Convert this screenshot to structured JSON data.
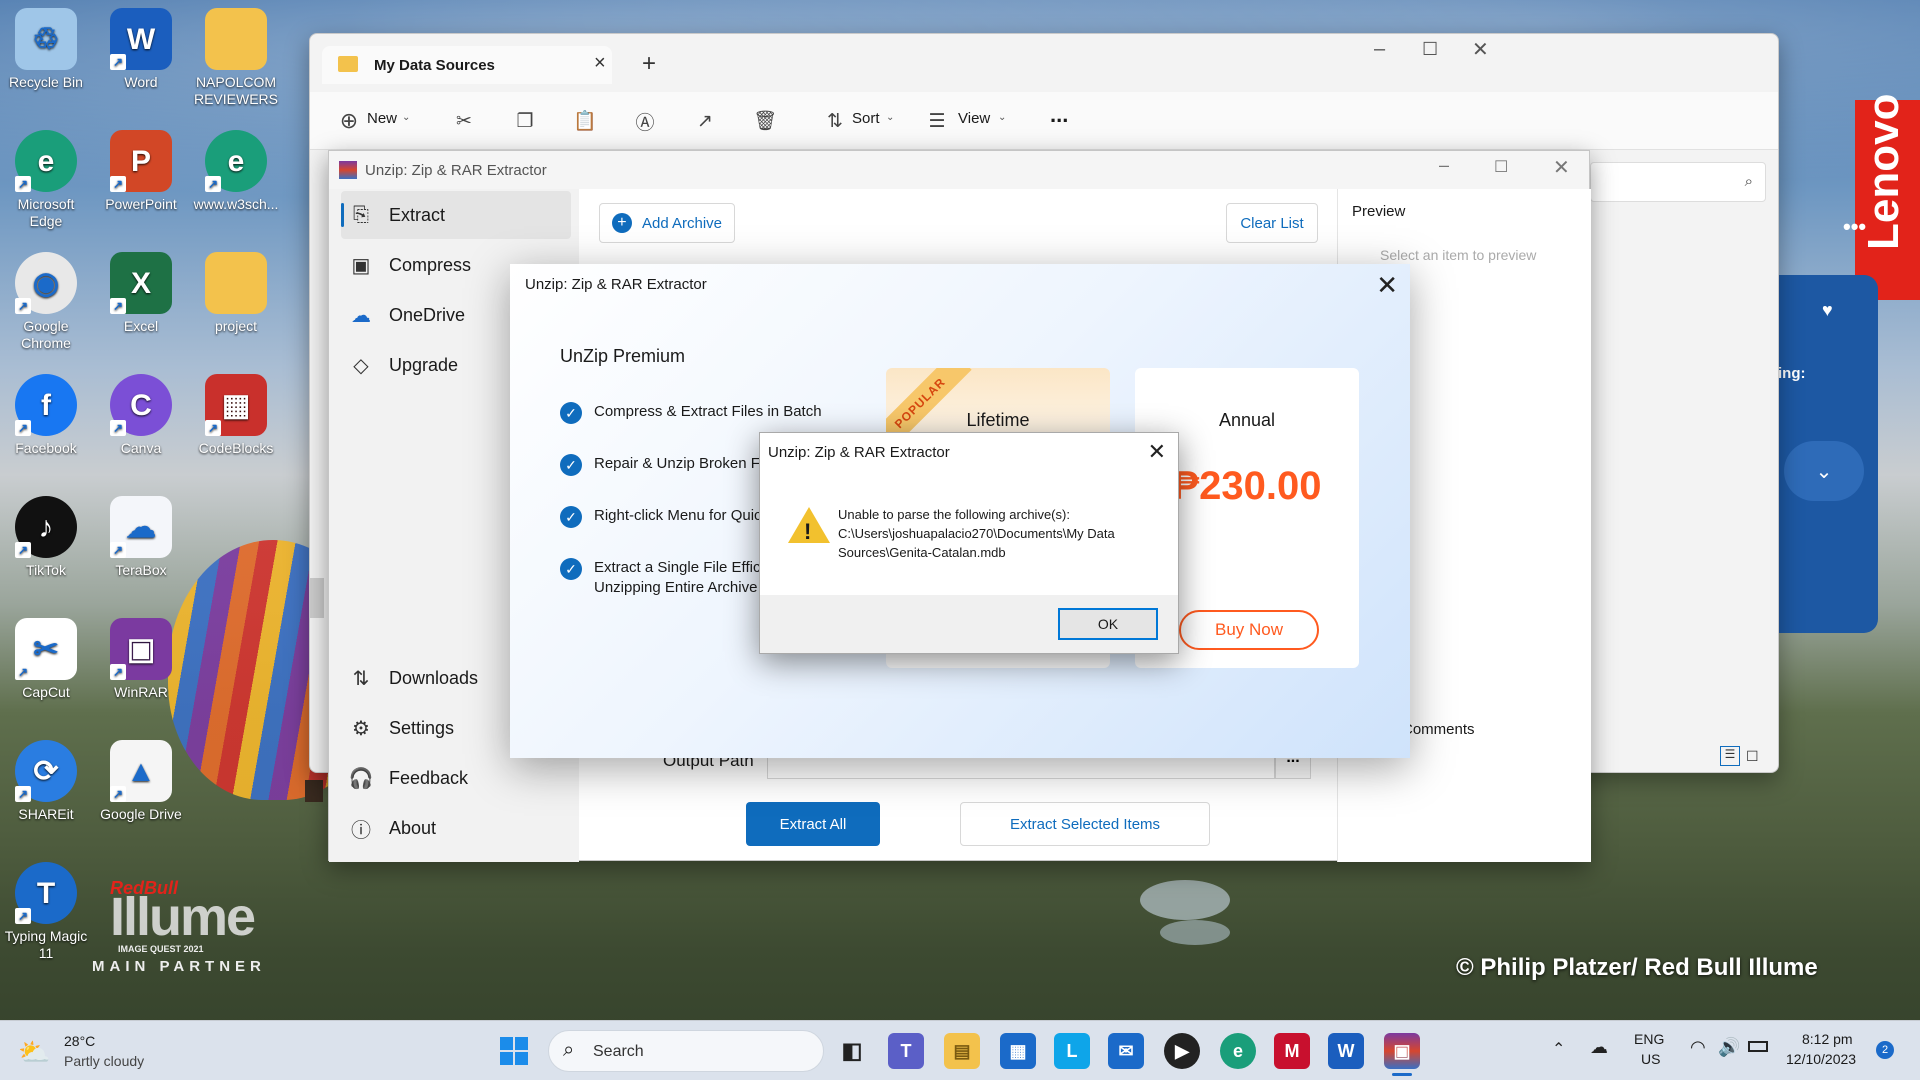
{
  "desktop": {
    "icons": [
      {
        "label": "Recycle Bin",
        "icon": "recycle-bin-icon"
      },
      {
        "label": "Word",
        "icon": "word-icon"
      },
      {
        "label": "NAPOLCOM REVIEWERS",
        "icon": "folder-icon"
      },
      {
        "label": "Microsoft Edge",
        "icon": "edge-icon"
      },
      {
        "label": "PowerPoint",
        "icon": "powerpoint-icon"
      },
      {
        "label": "www.w3sch...",
        "icon": "edge-icon"
      },
      {
        "label": "Google Chrome",
        "icon": "chrome-icon"
      },
      {
        "label": "Excel",
        "icon": "excel-icon"
      },
      {
        "label": "project",
        "icon": "folder-icon"
      },
      {
        "label": "Facebook",
        "icon": "facebook-icon"
      },
      {
        "label": "Canva",
        "icon": "canva-icon"
      },
      {
        "label": "CodeBlocks",
        "icon": "codeblocks-icon"
      },
      {
        "label": "TikTok",
        "icon": "tiktok-icon"
      },
      {
        "label": "TeraBox",
        "icon": "terabox-icon"
      },
      {
        "label": "CapCut",
        "icon": "capcut-icon"
      },
      {
        "label": "WinRAR",
        "icon": "winrar-icon"
      },
      {
        "label": "SHAREit",
        "icon": "shareit-icon"
      },
      {
        "label": "Google Drive",
        "icon": "google-drive-icon"
      },
      {
        "label": "Typing Magic 11",
        "icon": "typing-magic-icon"
      }
    ],
    "watermark": "© Philip Platzer/ Red Bull Illume",
    "illume_brand": "RedBull",
    "illume_word": "Illume",
    "illume_sub": "IMAGE QUEST 2021",
    "illume_partner": "MAIN PARTNER",
    "lenovo_text": "Lenovo",
    "widget_text": "ing:"
  },
  "explorer": {
    "tab_title": "My Data Sources",
    "new_label": "New",
    "sort_label": "Sort",
    "view_label": "View",
    "more_label": "...",
    "preview_header": "Preview",
    "preview_placeholder": "Select an item to preview",
    "comments_label": "Comments"
  },
  "unzip": {
    "title": "Unzip: Zip & RAR Extractor",
    "nav": {
      "extract": "Extract",
      "compress": "Compress",
      "onedrive": "OneDrive",
      "upgrade": "Upgrade",
      "downloads": "Downloads",
      "settings": "Settings",
      "feedback": "Feedback",
      "about": "About"
    },
    "add_archive": "Add Archive",
    "clear_list": "Clear List",
    "output_path_label": "Output Path",
    "output_path_value": "",
    "browse_label": "...",
    "extract_all": "Extract All",
    "extract_selected": "Extract Selected Items"
  },
  "premium": {
    "title": "Unzip: Zip & RAR Extractor",
    "heading": "UnZip Premium",
    "features": [
      "Compress & Extract Files in Batch",
      "Repair & Unzip Broken Fi",
      "Right-click Menu for Quic",
      "Extract a Single File Efficie",
      "Unzipping Entire Archive"
    ],
    "popular_badge": "POPULAR",
    "lifetime": "Lifetime",
    "annual": "Annual",
    "annual_price": "₱230.00",
    "buy_now": "Buy Now"
  },
  "error_dialog": {
    "title": "Unzip: Zip & RAR Extractor",
    "message_line1": "Unable to parse the following archive(s):",
    "message_line2": "C:\\Users\\joshuapalacio270\\Documents\\My Data",
    "message_line3": "Sources\\Genita-Catalan.mdb",
    "ok": "OK"
  },
  "taskbar": {
    "weather_temp": "28°C",
    "weather_desc": "Partly cloudy",
    "search_label": "Search",
    "lang_top": "ENG",
    "lang_bottom": "US",
    "time": "8:12 pm",
    "date": "12/10/2023",
    "notification_count": "2"
  }
}
